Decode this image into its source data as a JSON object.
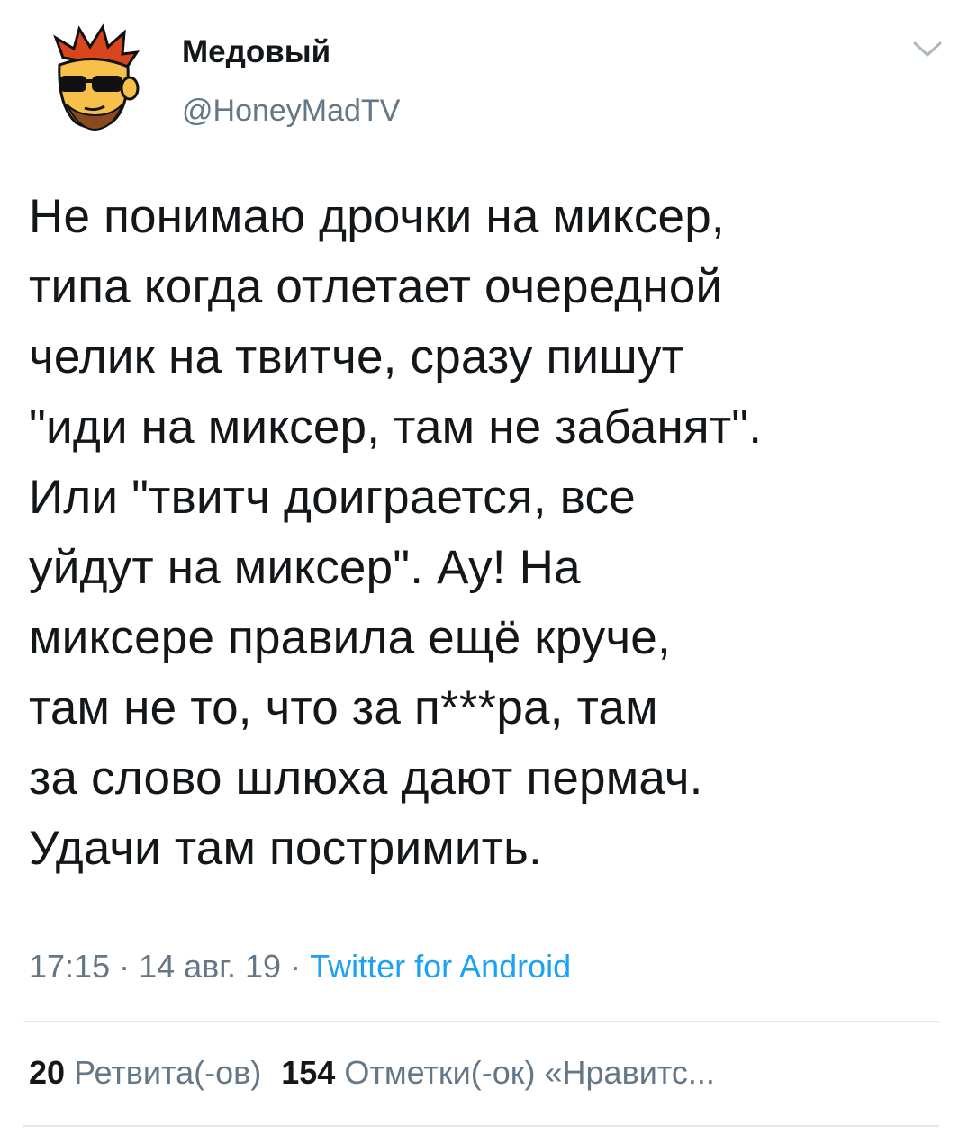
{
  "author": {
    "display_name": "Медовый",
    "handle": "@HoneyMadTV",
    "avatar_icon": "avatar-cartoon-sunglasses"
  },
  "header": {
    "menu_icon": "chevron-down-icon"
  },
  "tweet": {
    "text": "Не понимаю дрочки на миксер,\nтипа когда отлетает очередной\nчелик на твитче, сразу пишут\n\"иди на миксер, там не забанят\".\nИли \"твитч доиграется, все\nуйдут на миксер\". Ау! На\nмиксере правила ещё круче,\nтам не то, что за п***ра, там\nза слово шлюха дают пермач.\nУдачи там постримить."
  },
  "meta": {
    "time": "17:15",
    "separator": " · ",
    "date": "14 авг. 19",
    "source": "Twitter for Android"
  },
  "stats": {
    "retweets_count": "20",
    "retweets_label": "Ретвита(-ов)",
    "likes_count": "154",
    "likes_label": "Отметки(-ок) «Нравитс..."
  },
  "colors": {
    "text": "#14171a",
    "secondary": "#657786",
    "link": "#1da1f2",
    "divider": "#e1e8ed"
  }
}
